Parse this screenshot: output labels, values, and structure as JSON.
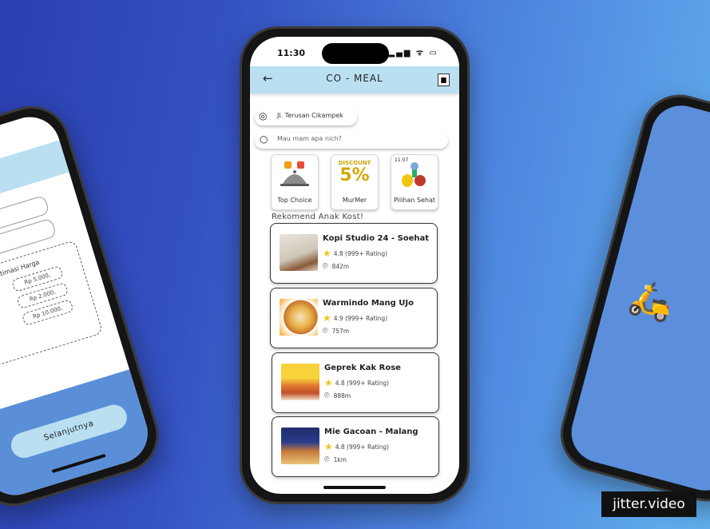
{
  "status_bar": {
    "time": "11:30",
    "icons": "▂▄▆ ᯤ ▭"
  },
  "header": {
    "title": "CO - MEAL",
    "back_icon": "←",
    "logo_icon": "▆"
  },
  "location": {
    "text": "Jl. Terusan Cikampek",
    "icon": "◎"
  },
  "search": {
    "placeholder": "Mau mam apa nich?",
    "icon": "○"
  },
  "categories": [
    {
      "label": "Top Choice"
    },
    {
      "label": "MurMer",
      "badge_top": "DISCOUNT",
      "badge_main": "5%"
    },
    {
      "label": "Pilihan Sehat",
      "status_time": "11:07"
    }
  ],
  "section_title": "Rekomend Anak Kost!",
  "restaurants": [
    {
      "name": "Kopi Studio 24 - Soehat",
      "rating": "4.8 (999+ Rating)",
      "distance": "842m"
    },
    {
      "name": "Warmindo Mang UJo",
      "rating": "4.9 (999+ Rating)",
      "distance": "757m"
    },
    {
      "name": "Geprek Kak Rose",
      "rating": "4.8  (999+ Rating)",
      "distance": "888m"
    },
    {
      "name": "Mie Gacoan - Malang",
      "rating": "4.8 (999+ Rating)",
      "distance": "1km"
    }
  ],
  "left_phone": {
    "section": "Estimasi Harga",
    "prices": [
      "Rp 5.000,",
      "Rp 2.000,",
      "Rp 10.000,"
    ],
    "button": "Selanjutnya"
  },
  "watermark": "jitter.video",
  "colors": {
    "header_bg": "#b9dff1",
    "accent_blue": "#5b8fdc",
    "star": "#f0c419"
  }
}
